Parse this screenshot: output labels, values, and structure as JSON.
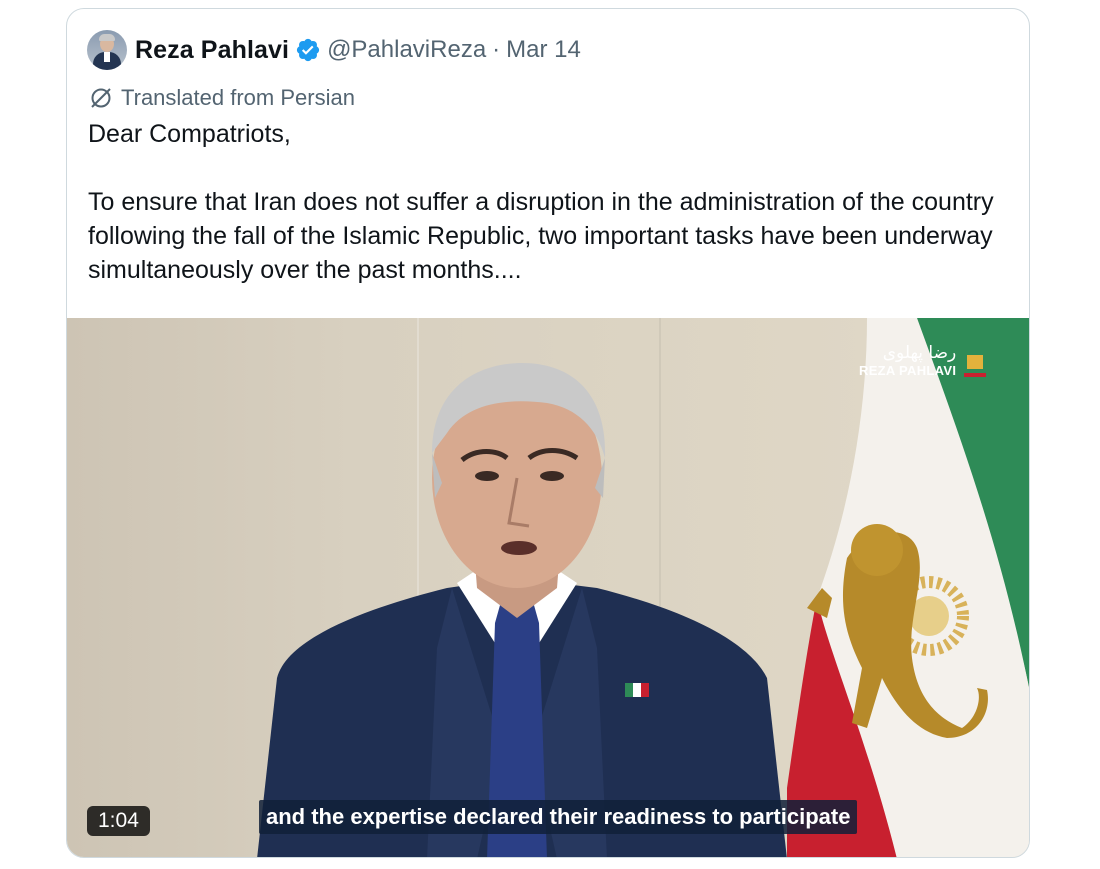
{
  "tweet": {
    "author_name": "Reza Pahlavi",
    "handle": "@PahlaviReza",
    "separator": "·",
    "date": "Mar 14",
    "translated_label": "Translated from Persian",
    "text": "Dear Compatriots,\n\nTo ensure that Iran does not suffer a disruption in the administration of the country following the fall of the Islamic Republic, two important tasks have been underway simultaneously over the past months...."
  },
  "video": {
    "duration": "1:04",
    "subtitle": "and the expertise declared their readiness to participate",
    "watermark_fa": "رضا پهلوی",
    "watermark_en": "REZA PAHLAVI"
  },
  "icons": {
    "verified": "verified-badge-icon",
    "translate": "translate-icon"
  },
  "colors": {
    "verified_blue": "#1d9bf0",
    "secondary_text": "#536471",
    "border": "#cfd9de"
  }
}
